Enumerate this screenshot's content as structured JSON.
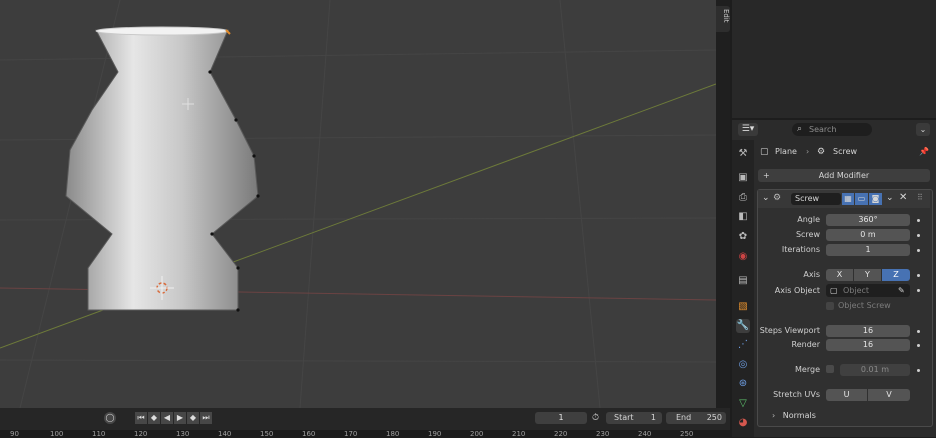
{
  "sidebar_tab": "Edit",
  "header": {
    "search_placeholder": "Search",
    "breadcrumb_object": "Plane",
    "breadcrumb_modifier": "Screw"
  },
  "add_modifier": "Add Modifier",
  "modifier": {
    "name": "Screw",
    "angle_label": "Angle",
    "angle_value": "360°",
    "screw_label": "Screw",
    "screw_value": "0 m",
    "iterations_label": "Iterations",
    "iterations_value": "1",
    "axis_label": "Axis",
    "axis_options": [
      "X",
      "Y",
      "Z"
    ],
    "axis_selected": "Z",
    "axis_object_label": "Axis Object",
    "axis_object_placeholder": "Object",
    "object_screw_label": "Object Screw",
    "steps_viewport_label": "Steps Viewport",
    "steps_viewport_value": "16",
    "render_label": "Render",
    "render_value": "16",
    "merge_label": "Merge",
    "merge_value": "0.01 m",
    "stretch_uvs_label": "Stretch UVs",
    "stretch_u": "U",
    "stretch_v": "V",
    "normals_label": "Normals"
  },
  "timeline": {
    "current_frame": "1",
    "start_label": "Start",
    "start_value": "1",
    "end_label": "End",
    "end_value": "250"
  },
  "ruler_ticks": [
    "90",
    "100",
    "110",
    "120",
    "130",
    "140",
    "150",
    "160",
    "170",
    "180",
    "190",
    "200",
    "210",
    "220",
    "230",
    "240",
    "250"
  ],
  "colors": {
    "accent_blue": "#4772b3",
    "viewport_bg": "#3d3d3d",
    "panel_bg": "#2b2b2b"
  }
}
